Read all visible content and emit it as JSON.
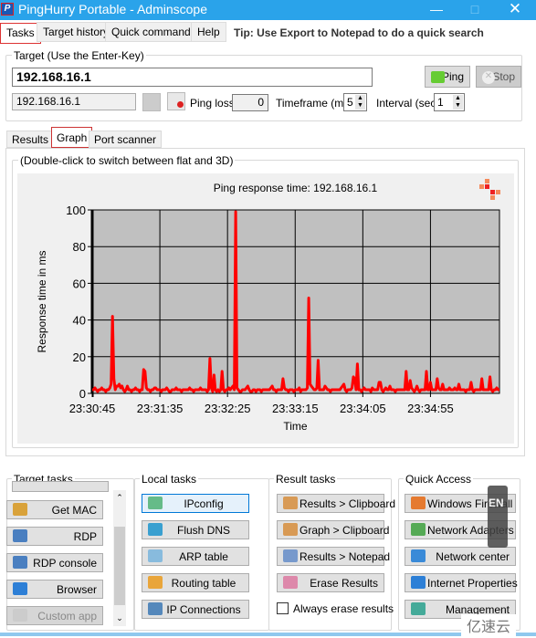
{
  "window": {
    "title": "PingHurry Portable - Adminscope",
    "app_icon_letter": "P"
  },
  "menu": {
    "tabs": [
      "Tasks",
      "Target history",
      "Quick commands",
      "Help"
    ],
    "active": "Tasks",
    "tip": "Tip: Use Export to Notepad to do a quick search"
  },
  "target": {
    "group_label": "Target (Use the Enter-Key)",
    "value": "192.168.16.1",
    "resolved": "192.168.16.1",
    "ping_label": "Ping",
    "stop_label": "Stop",
    "ping_loss_label": "Ping loss",
    "ping_loss_value": "0",
    "timeframe_label": "Timeframe (min)",
    "timeframe_value": "5",
    "interval_label": "Interval (sec)",
    "interval_value": "1"
  },
  "subtabs": {
    "items": [
      "Results",
      "Graph",
      "Port scanner"
    ],
    "active": "Graph"
  },
  "graph": {
    "group_label": "(Double-click to switch between flat and 3D)"
  },
  "chart_data": {
    "type": "line",
    "title": "Ping response time: 192.168.16.1",
    "xlabel": "Time",
    "ylabel": "Response time in ms",
    "ylim": [
      0,
      100
    ],
    "yticks": [
      0,
      20,
      40,
      60,
      80,
      100
    ],
    "xticks": [
      "23:30:45",
      "23:31:35",
      "23:32:25",
      "23:33:15",
      "23:34:05",
      "23:34:55"
    ],
    "x_start": "23:30:45",
    "x_interval_sec": 1,
    "grid": true,
    "series_color": "#ff0000",
    "plot_background": "#c0c0c0",
    "values": [
      2,
      2,
      3,
      2,
      1,
      2,
      2,
      3,
      2,
      2,
      1,
      2,
      2,
      3,
      5,
      42,
      8,
      2,
      4,
      4,
      5,
      3,
      4,
      2,
      1,
      2,
      4,
      2,
      2,
      1,
      2,
      2,
      3,
      2,
      2,
      1,
      2,
      2,
      13,
      12,
      3,
      2,
      2,
      1,
      2,
      2,
      3,
      3,
      2,
      2,
      2,
      1,
      2,
      2,
      2,
      3,
      2,
      1,
      1,
      2,
      2,
      2,
      3,
      2,
      2,
      2,
      1,
      2,
      2,
      2,
      2,
      2,
      3,
      2,
      2,
      1,
      2,
      2,
      2,
      2,
      3,
      2,
      2,
      2,
      2,
      1,
      2,
      19,
      3,
      1,
      10,
      2,
      1,
      2,
      1,
      2,
      12,
      2,
      1,
      2,
      2,
      3,
      2,
      3,
      4,
      2,
      99,
      3,
      2,
      1,
      1,
      2,
      2,
      2,
      3,
      4,
      2,
      1,
      1,
      2,
      2,
      1,
      2,
      2,
      2,
      1,
      2,
      2,
      2,
      2,
      2,
      2,
      3,
      4,
      2,
      2,
      1,
      2,
      2,
      2,
      2,
      8,
      3,
      2,
      2,
      1,
      2,
      2,
      2,
      1,
      2,
      2,
      2,
      3,
      1,
      2,
      2,
      2,
      2,
      3,
      52,
      5,
      4,
      3,
      2,
      2,
      3,
      18,
      2,
      2,
      2,
      2,
      4,
      3,
      2,
      2,
      1,
      2,
      2,
      2,
      2,
      2,
      2,
      2,
      3,
      4,
      5,
      2,
      1,
      2,
      2,
      2,
      3,
      9,
      8,
      2,
      16,
      2,
      2,
      1,
      2,
      3,
      2,
      2,
      2,
      2,
      1,
      3,
      2,
      2,
      2,
      2,
      6,
      6,
      2,
      1,
      2,
      3,
      2,
      2,
      4,
      2,
      2,
      2,
      1,
      2,
      2,
      2,
      2,
      2,
      2,
      2,
      12,
      2,
      2,
      7,
      3,
      2,
      1,
      2,
      4,
      2,
      1,
      2,
      2,
      2,
      2,
      12,
      2,
      2,
      6,
      2,
      2,
      2,
      2,
      8,
      3,
      2,
      2,
      5,
      2,
      2,
      2,
      2,
      3,
      2,
      2,
      2,
      3,
      2,
      2,
      5,
      2,
      2,
      2,
      2,
      1,
      2,
      2,
      2,
      6,
      2,
      1,
      2,
      2,
      2,
      2,
      2,
      8,
      2,
      2,
      2,
      2,
      2,
      9,
      2,
      1,
      2,
      2,
      3,
      2,
      2
    ]
  },
  "target_tasks": {
    "label": "Target tasks",
    "buttons": [
      {
        "label": "Get MAC",
        "icon": "burger-icon"
      },
      {
        "label": "RDP",
        "icon": "monitor-icon"
      },
      {
        "label": "RDP console",
        "icon": "monitor-icon"
      },
      {
        "label": "Browser",
        "icon": "ie-icon"
      },
      {
        "label": "Custom app",
        "icon": "app-icon",
        "disabled": true
      }
    ]
  },
  "local_tasks": {
    "label": "Local tasks",
    "buttons": [
      {
        "label": "IPconfig",
        "icon": "network-icon"
      },
      {
        "label": "Flush DNS",
        "icon": "dns-icon"
      },
      {
        "label": "ARP table",
        "icon": "table-icon"
      },
      {
        "label": "Routing table",
        "icon": "routing-icon"
      },
      {
        "label": "IP Connections",
        "icon": "link-icon"
      }
    ]
  },
  "result_tasks": {
    "label": "Result tasks",
    "buttons": [
      {
        "label": "Results > Clipboard",
        "icon": "clipboard-icon"
      },
      {
        "label": "Graph > Clipboard",
        "icon": "clipboard-icon"
      },
      {
        "label": "Results > Notepad",
        "icon": "notepad-icon"
      },
      {
        "label": "Erase Results",
        "icon": "eraser-icon"
      }
    ],
    "checkbox_label": "Always erase results",
    "checkbox_checked": false
  },
  "quick_access": {
    "label": "Quick Access",
    "buttons": [
      {
        "label": "Windows Firewall",
        "icon": "firewall-icon"
      },
      {
        "label": "Network Adapters",
        "icon": "adapter-icon"
      },
      {
        "label": "Network center",
        "icon": "network-center-icon"
      },
      {
        "label": "Internet Properties",
        "icon": "ie-icon"
      },
      {
        "label": "Management",
        "icon": "management-icon"
      }
    ]
  },
  "overlay": {
    "ime": "EN",
    "watermark": "亿速云"
  }
}
